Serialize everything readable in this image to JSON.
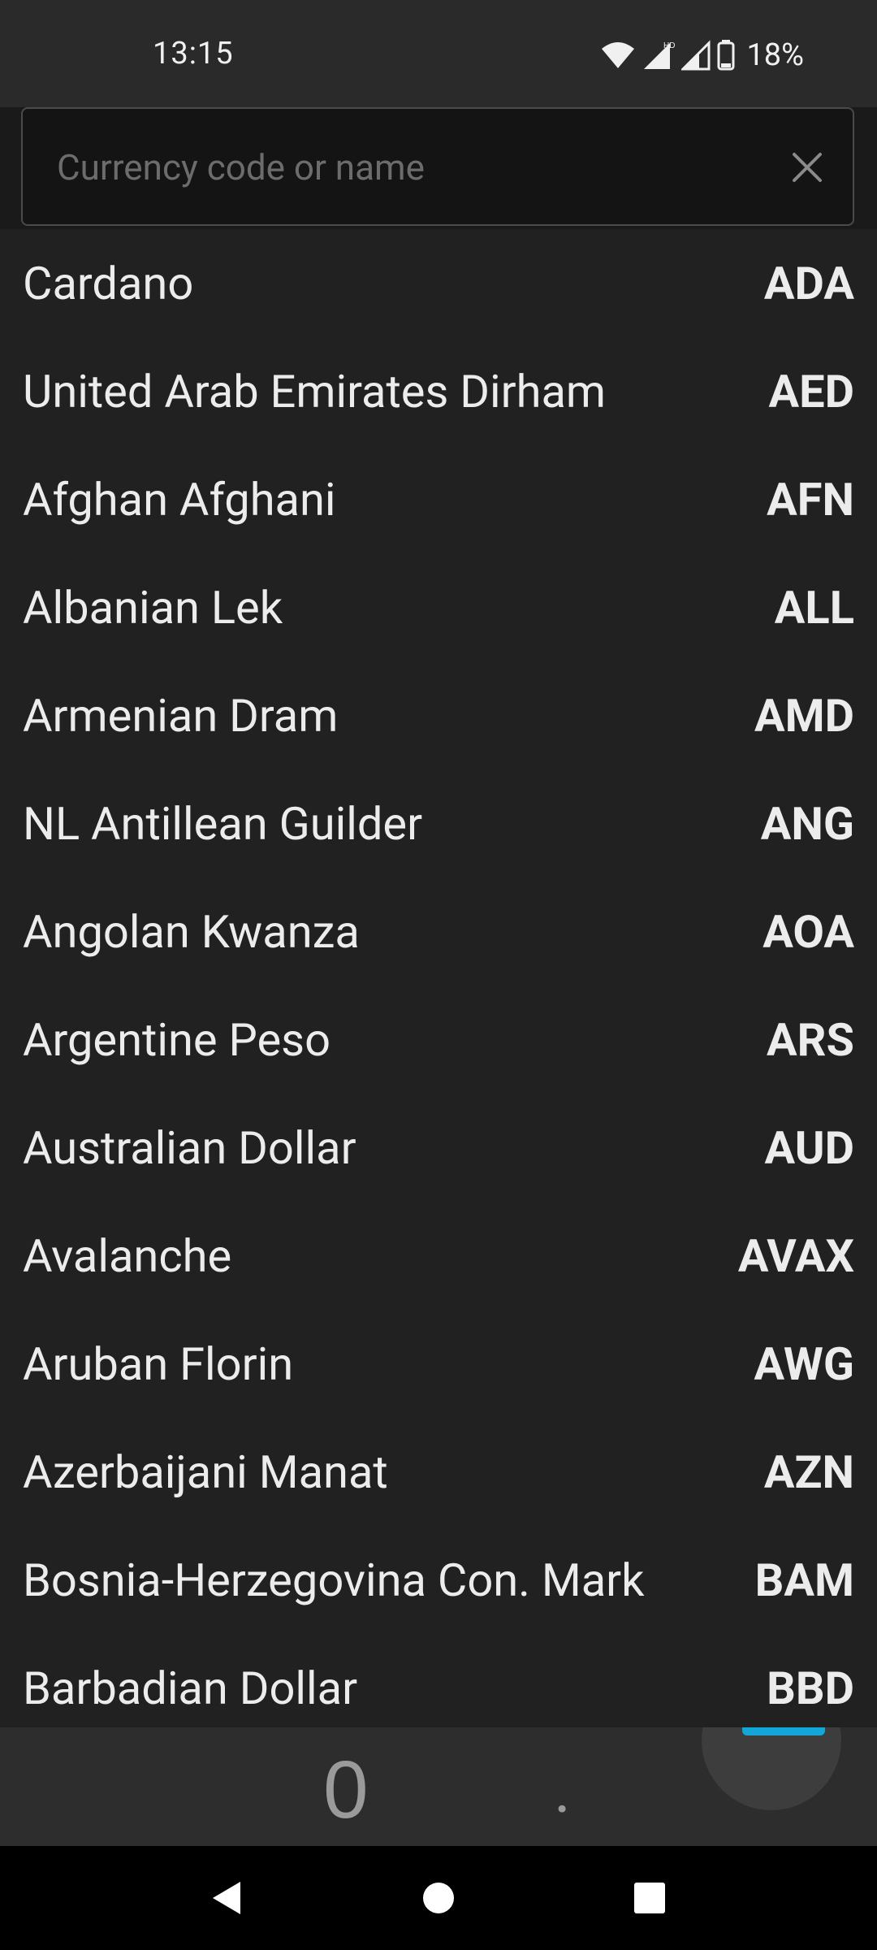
{
  "status_bar": {
    "time": "13:15",
    "battery": "18%",
    "icons": [
      "wifi-icon",
      "signal-icon",
      "signal-icon",
      "battery-icon"
    ]
  },
  "search": {
    "placeholder": "Currency code or name",
    "value": ""
  },
  "currencies": [
    {
      "name": "Cardano",
      "code": "ADA"
    },
    {
      "name": "United Arab Emirates Dirham",
      "code": "AED"
    },
    {
      "name": "Afghan Afghani",
      "code": "AFN"
    },
    {
      "name": "Albanian Lek",
      "code": "ALL"
    },
    {
      "name": "Armenian Dram",
      "code": "AMD"
    },
    {
      "name": "NL Antillean Guilder",
      "code": "ANG"
    },
    {
      "name": "Angolan Kwanza",
      "code": "AOA"
    },
    {
      "name": "Argentine Peso",
      "code": "ARS"
    },
    {
      "name": "Australian Dollar",
      "code": "AUD"
    },
    {
      "name": "Avalanche",
      "code": "AVAX"
    },
    {
      "name": "Aruban Florin",
      "code": "AWG"
    },
    {
      "name": "Azerbaijani Manat",
      "code": "AZN"
    },
    {
      "name": "Bosnia-Herzegovina Con. Mark",
      "code": "BAM"
    },
    {
      "name": "Barbadian Dollar",
      "code": "BBD"
    }
  ],
  "keypad": {
    "zero": "0",
    "dot": "."
  },
  "colors": {
    "accent": "#14a6d8",
    "background": "#202020"
  }
}
